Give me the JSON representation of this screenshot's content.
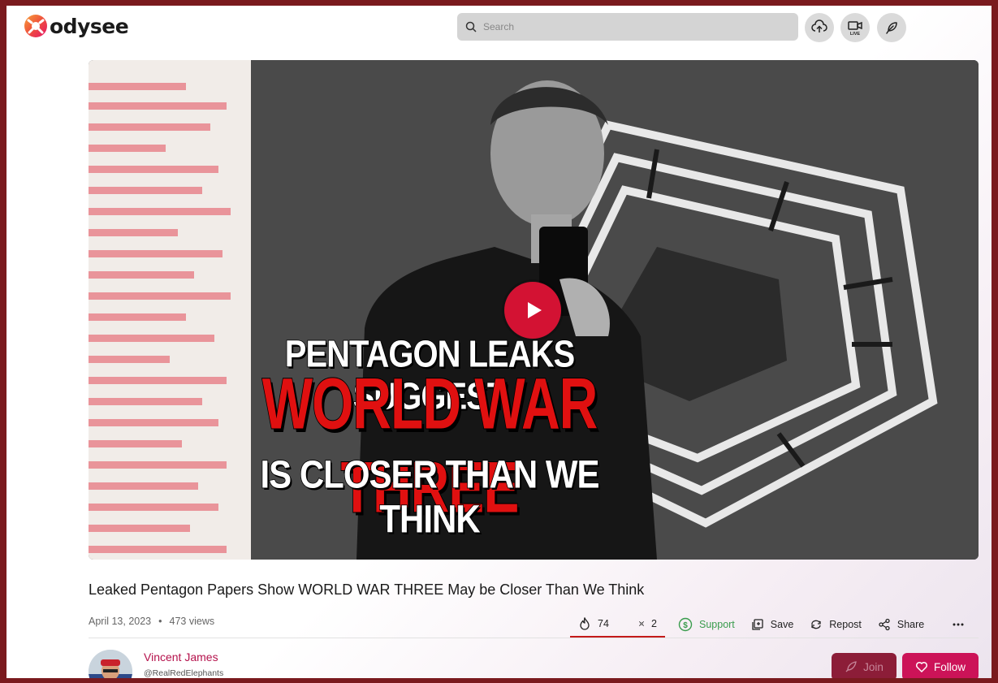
{
  "header": {
    "brand": "odysee",
    "search": {
      "placeholder": "Search",
      "value": ""
    },
    "buttons": [
      {
        "icon": "upload-cloud-icon"
      },
      {
        "icon": "live-camera-icon",
        "label": "LIVE"
      },
      {
        "icon": "feather-pen-icon"
      }
    ]
  },
  "video": {
    "thumbnail_lines": [
      "PENTAGON LEAKS SUGGEST",
      "WORLD WAR THREE",
      "IS CLOSER THAN WE THINK"
    ],
    "play_icon": "play-icon"
  },
  "content": {
    "title": "Leaked Pentagon Papers Show WORLD WAR THREE May be Closer Than We Think",
    "date": "April 13, 2023",
    "separator": "•",
    "views": "473 views"
  },
  "actions": {
    "fire_count": "74",
    "slime_count": "2",
    "support_label": "Support",
    "save_label": "Save",
    "repost_label": "Repost",
    "share_label": "Share",
    "more_icon": "more-horizontal-icon"
  },
  "channel": {
    "name": "Vincent James",
    "handle": "@RealRedElephants",
    "join_label": "Join",
    "follow_label": "Follow"
  },
  "colors": {
    "brand_red": "#cc1358",
    "join_bg": "#8c1d38",
    "support_green": "#3a9c4d",
    "channel_name": "#b5124c",
    "page_border": "#7a1a1e"
  }
}
